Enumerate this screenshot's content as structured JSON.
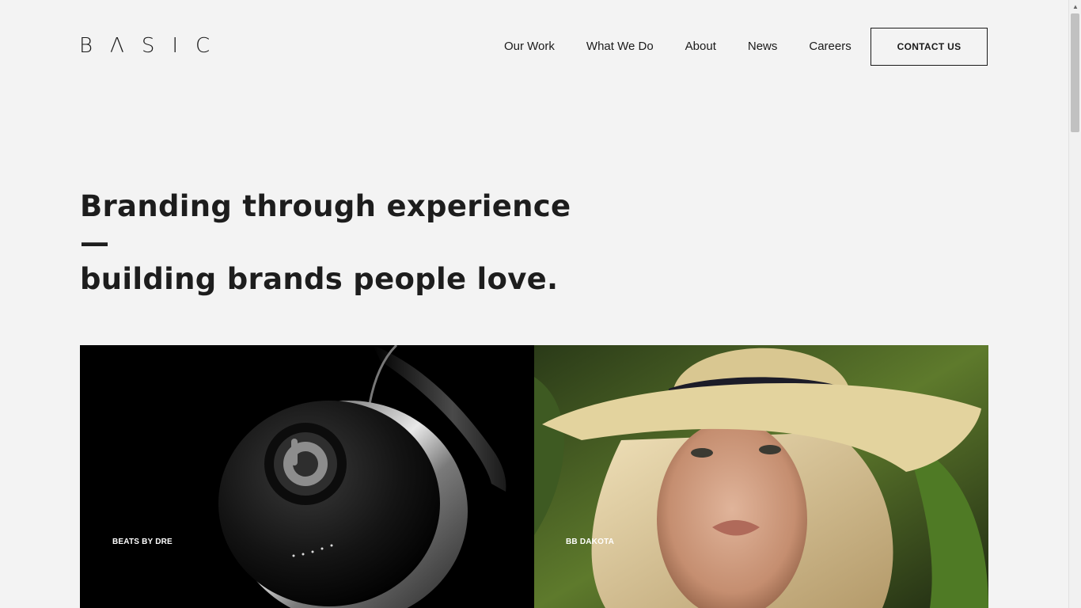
{
  "brand": {
    "logo_letters": [
      "B",
      "Λ",
      "S",
      "I",
      "C"
    ]
  },
  "nav": {
    "items": [
      "Our Work",
      "What We Do",
      "About",
      "News",
      "Careers"
    ],
    "contact_label": "CONTACT US"
  },
  "hero": {
    "line1": "Branding through experience —",
    "line2": "building brands people love."
  },
  "projects": [
    {
      "label": "BEATS BY DRE"
    },
    {
      "label": "BB DAKOTA"
    }
  ],
  "colors": {
    "background": "#f3f3f3",
    "text": "#1a1a1a",
    "white": "#ffffff"
  },
  "scrollbar": {
    "up_icon": "▲"
  }
}
